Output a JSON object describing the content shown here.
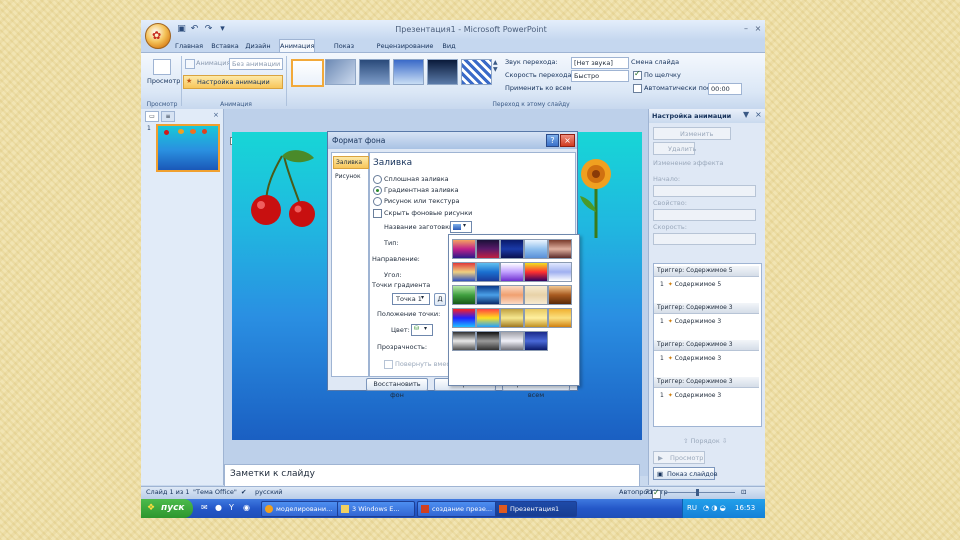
{
  "titlebar": {
    "title": "Презентация1 - Microsoft PowerPoint"
  },
  "tabs": [
    "Главная",
    "Вставка",
    "Дизайн",
    "Анимация",
    "Показ слайдов",
    "Рецензирование",
    "Вид"
  ],
  "ribbon": {
    "preview_label": "Просмотр",
    "group_preview": "Просмотр",
    "animation_label": "Анимация:",
    "animation_value": "Без анимации",
    "custom_animation": "Настройка анимации",
    "group_animation": "Анимация",
    "group_transition": "Переход к этому слайду",
    "sound_label": "Звук перехода:",
    "sound_value": "[Нет звука]",
    "speed_label": "Скорость перехода:",
    "speed_value": "Быстро",
    "apply_all": "Применить ко всем",
    "change_slide": "Смена слайда",
    "on_click": "По щелчку",
    "auto_after": "Автоматически после:",
    "auto_time": "00:00"
  },
  "main": {
    "notes_placeholder": "Заметки к слайду"
  },
  "dialog": {
    "title": "Формат фона",
    "nav_fill": "Заливка",
    "nav_picture": "Рисунок",
    "section": "Заливка",
    "opt_solid": "Сплошная заливка",
    "opt_gradient": "Градиентная заливка",
    "opt_picture": "Рисунок или текстура",
    "hide_bg": "Скрыть фоновые рисунки",
    "preset_label": "Название заготовки:",
    "type_label": "Тип:",
    "direction_label": "Направление:",
    "angle_label": "Угол:",
    "stops_label": "Точки градиента",
    "stop_value": "Точка 1",
    "stop_position": "Положение точки:",
    "color_label": "Цвет:",
    "transparency_label": "Прозрачность:",
    "rotate_with_shape": "Повернуть вместе с фигурой",
    "btn_reset": "Восстановить фон",
    "btn_close": "Закрыть",
    "btn_apply_all": "Применить ко всем"
  },
  "gradients": [
    [
      "#f4a260",
      "#c0208a",
      "#2a1a8a"
    ],
    [
      "#1a1038",
      "#5a1a6a",
      "#c02040"
    ],
    [
      "#0a1a6a",
      "#1a3aa8",
      "#0a1050"
    ],
    [
      "#eaf4ff",
      "#90c0ee",
      "#5a90d8"
    ],
    [
      "#7a3a2a",
      "#e0b0a0",
      "#5a2a2a"
    ],
    [
      "#e03a3a",
      "#f0d080",
      "#3050c0"
    ],
    [
      "#60c0f0",
      "#1a70d0",
      "#1a3a9a"
    ],
    [
      "#ffffff",
      "#c0a0ff",
      "#7030d0"
    ],
    [
      "#f0e020",
      "#ff3030",
      "#300060"
    ],
    [
      "#e0e8ff",
      "#a0b0f0",
      "#ffffff"
    ],
    [
      "#b8e8a8",
      "#40a040",
      "#185818"
    ],
    [
      "#0a3a8a",
      "#4aa0e8",
      "#0a2a6a"
    ],
    [
      "#fbd9c4",
      "#f0a070",
      "#fbd9c4"
    ],
    [
      "#f6ead0",
      "#e8d2a8",
      "#f6ead0"
    ],
    [
      "#f4c890",
      "#a85a20",
      "#5a2a08"
    ],
    [
      "#ff2020",
      "#2020ff",
      "#20c0ff"
    ],
    [
      "#ff4040",
      "#ffe020",
      "#20a0ff"
    ],
    [
      "#c0a040",
      "#f6e890",
      "#a07820"
    ],
    [
      "#e8c860",
      "#fff0a0",
      "#c09020"
    ],
    [
      "#f0b030",
      "#fbe080",
      "#d08010"
    ],
    [
      "#303030",
      "#e8e8e8",
      "#505050"
    ],
    [
      "#101010",
      "#9a9a9a",
      "#303030"
    ],
    [
      "#a0a0a8",
      "#f0f0f8",
      "#707078"
    ],
    [
      "#1a2a8a",
      "#4a6ad8",
      "#0a1a6a"
    ]
  ],
  "right_pane": {
    "title": "Настройка анимации",
    "change_btn": "Изменить",
    "remove_btn": "Удалить",
    "effect_header": "Изменение эффекта",
    "start_label": "Начало:",
    "property_label": "Свойство:",
    "speed_label": "Скорость:",
    "items": [
      {
        "trigger": "Триггер: Содержимое 5",
        "num": "1",
        "name": "Содержимое 5"
      },
      {
        "trigger": "Триггер: Содержимое 3",
        "num": "1",
        "name": "Содержимое 3"
      },
      {
        "trigger": "Триггер: Содержимое 3",
        "num": "1",
        "name": "Содержимое 3"
      },
      {
        "trigger": "Триггер: Содержимое 3",
        "num": "1",
        "name": "Содержимое 3"
      }
    ],
    "order_label": "Порядок",
    "preview_btn": "Просмотр",
    "slideshow_btn": "Показ слайдов",
    "autopreview": "Автопросмотр"
  },
  "statusbar": {
    "slide": "Слайд 1 из 1",
    "theme": "\"Тема Office\"",
    "lang": "русский",
    "zoom": "71%"
  },
  "taskbar": {
    "start": "пуск",
    "tasks": [
      "моделировани...",
      "3 Windows E...",
      "создание презе...",
      "Презентация1"
    ],
    "lang": "RU",
    "time": "16:53"
  }
}
